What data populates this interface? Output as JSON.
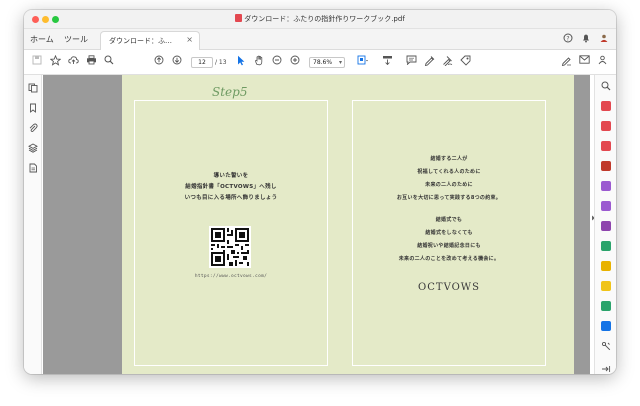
{
  "window": {
    "title": "ダウンロード：ふたりの指針作りワークブック.pdf"
  },
  "tabs": {
    "home": "ホーム",
    "tools": "ツール",
    "document": "ダウンロード：ふ…",
    "close_glyph": "×"
  },
  "header_icons": {
    "help": "?",
    "bell": "🔔",
    "account": "👤"
  },
  "toolbar": {
    "page_current": "12",
    "page_total": "/ 13",
    "zoom": "78.6%",
    "zoom_caret": "▾"
  },
  "page": {
    "step_label": "Step5",
    "left_lines": [
      "導いた誓いを",
      "結婚指針書「OCTVOWS」へ残し",
      "いつも目に入る場所へ飾りましょう"
    ],
    "url": "https://www.octvows.com/",
    "right_block_1": [
      "結婚する二人が",
      "祝福してくれる人のために",
      "未来の二人のために",
      "お互いを大切に思って実践する8つの約束。"
    ],
    "right_block_2": [
      "結婚式でも",
      "結婚式をしなくても",
      "結婚祝いや結婚記念日にも",
      "未来の二人のことを改めて考える機会に。"
    ],
    "logo": "OCTVOWS"
  },
  "colors": {
    "page_bg": "#e4eac8",
    "step_green": "#6e9a62",
    "accent_blue": "#1473e6"
  },
  "right_tools": [
    {
      "name": "search-tool",
      "color": "#555555"
    },
    {
      "name": "export-pdf-tool",
      "color": "#e34850"
    },
    {
      "name": "edit-pdf-tool",
      "color": "#e34850"
    },
    {
      "name": "create-pdf-tool",
      "color": "#e34850"
    },
    {
      "name": "organize-pages-tool",
      "color": "#e34850"
    },
    {
      "name": "combine-files-tool",
      "color": "#9b59d0"
    },
    {
      "name": "fill-sign-tool",
      "color": "#9b59d0"
    },
    {
      "name": "request-signature-tool",
      "color": "#9b59d0"
    },
    {
      "name": "scan-ocr-tool",
      "color": "#2aa36b"
    },
    {
      "name": "comment-tool",
      "color": "#e8b200"
    },
    {
      "name": "share-tool",
      "color": "#e8b200"
    },
    {
      "name": "compress-tool",
      "color": "#2aa36b"
    },
    {
      "name": "print-production-tool",
      "color": "#2aa36b"
    },
    {
      "name": "protect-tool",
      "color": "#1473e6"
    },
    {
      "name": "more-tools",
      "color": "#555555"
    }
  ]
}
